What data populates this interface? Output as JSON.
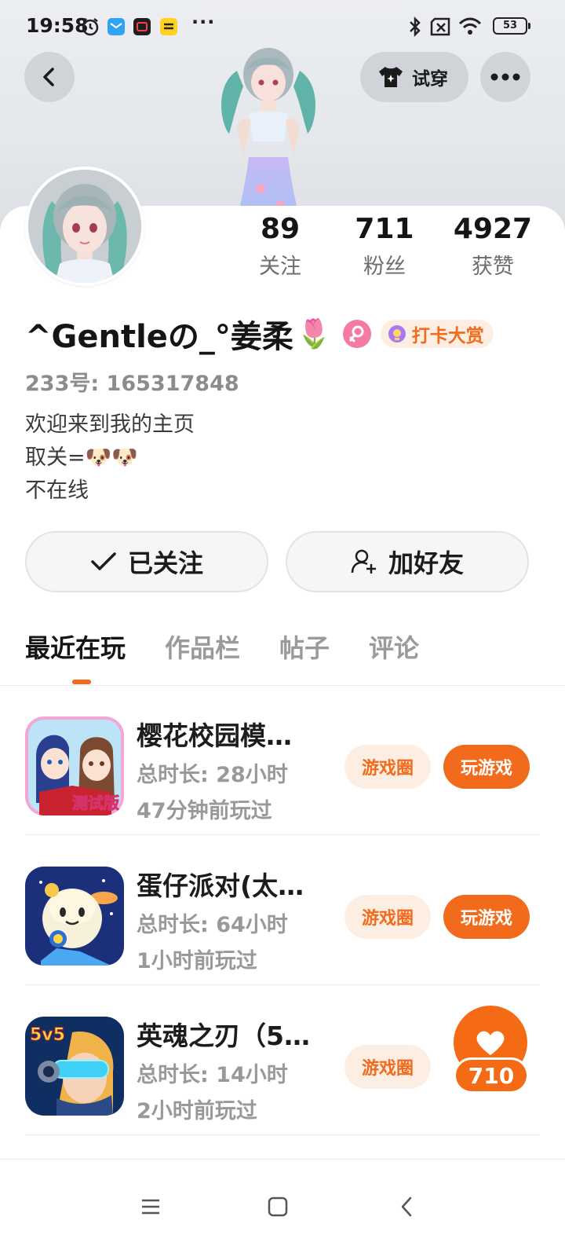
{
  "status_bar": {
    "time": "19:58",
    "dots": "···",
    "battery": "53",
    "left_icons": [
      "alarm-icon",
      "mail-app-icon",
      "video-app-icon",
      "kuaishou-app-icon"
    ],
    "right_icons": [
      "bluetooth-icon",
      "sim-off-icon",
      "wifi-icon",
      "battery-icon"
    ]
  },
  "header": {
    "back_icon": "chevron-left-icon",
    "try_on_label": "试穿",
    "try_on_icon": "tshirt-sparkle-icon",
    "more_icon": "more-dots-icon"
  },
  "profile": {
    "stats": [
      {
        "value": "89",
        "label": "关注"
      },
      {
        "value": "711",
        "label": "粉丝"
      },
      {
        "value": "4927",
        "label": "获赞"
      }
    ],
    "name": "^Gentleの_°姜柔",
    "name_emoji": "🌷",
    "gender_icon": "female-symbol-icon",
    "checkin_badge": "打卡大赏",
    "id_line": "233号: 165317848",
    "bio_lines": [
      "欢迎来到我的主页",
      "取关=🐶🐶",
      "不在线"
    ]
  },
  "actions": {
    "following_label": "已关注",
    "add_friend_label": "加好友"
  },
  "tabs": [
    "最近在玩",
    "作品栏",
    "帖子",
    "评论"
  ],
  "active_tab": 0,
  "games": [
    {
      "title": "樱花校园模…",
      "total_time": "总时长: 28小时",
      "last_played": "47分钟前玩过",
      "circle_label": "游戏圈",
      "play_label": "玩游戏"
    },
    {
      "title": "蛋仔派对(太…",
      "total_time": "总时长: 64小时",
      "last_played": "1小时前玩过",
      "circle_label": "游戏圈",
      "play_label": "玩游戏"
    },
    {
      "title": "英魂之刃（5…",
      "total_time": "总时长: 14小时",
      "last_played": "2小时前玩过",
      "circle_label": "游戏圈"
    }
  ],
  "like_float": {
    "count": "710",
    "icon": "heart-icon"
  },
  "game_icon_text": {
    "sakura": "测试版",
    "yinghun": "5v5"
  },
  "colors": {
    "accent": "#f26a1b",
    "accent_light": "#fdeee4",
    "text_secondary": "#999999"
  }
}
